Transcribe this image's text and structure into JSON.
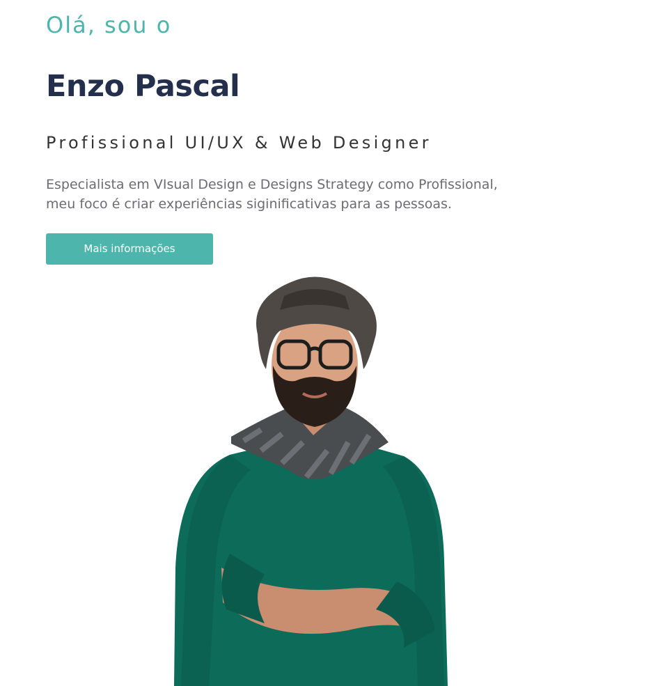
{
  "hero": {
    "greeting": "Olá, sou o",
    "name": "Enzo Pascal",
    "role": "Profissional UI/UX & Web Designer",
    "description_line1": "Especialista em VIsual Design e Designs Strategy como Profissional,",
    "description_line2": "meu foco é criar experiências siginificativas para as pessoas.",
    "cta_label": "Mais informações"
  },
  "colors": {
    "accent": "#4db5ab",
    "name_color": "#232f4b",
    "role_color": "#333333",
    "text_muted": "#6b6b73",
    "button_text": "#ffffff",
    "background": "#ffffff"
  },
  "portrait": {
    "subject": "bearded man with hat, glasses, scarf and green sweater, arms crossed"
  }
}
